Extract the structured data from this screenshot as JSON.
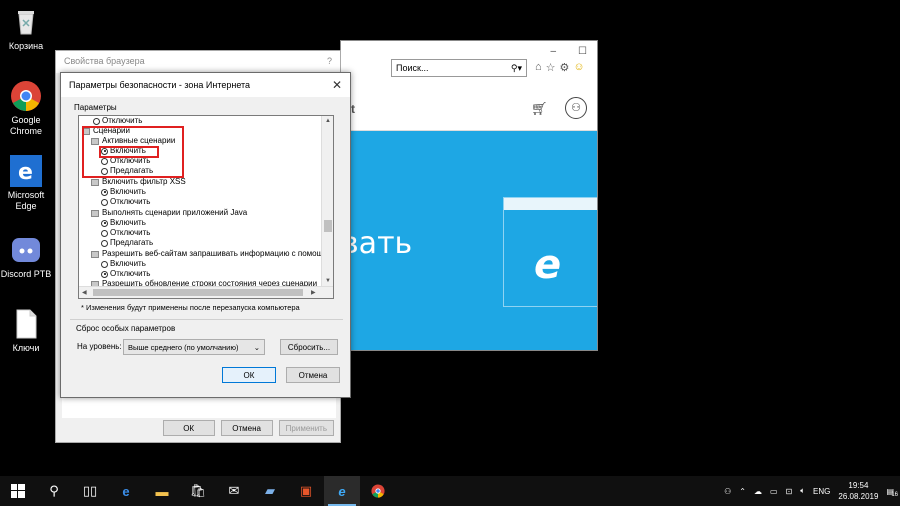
{
  "desktop": {
    "icons": [
      {
        "label": "Корзина",
        "icon": "recycle-bin-icon"
      },
      {
        "label": "Google Chrome",
        "icon": "chrome-icon"
      },
      {
        "label": "Microsoft Edge",
        "icon": "edge-icon"
      },
      {
        "label": "Discord PTB",
        "icon": "discord-icon"
      },
      {
        "label": "Ключи",
        "icon": "file-icon"
      }
    ]
  },
  "ie": {
    "search_placeholder": "Поиск...",
    "header_text": "ft",
    "hero_text": "вать",
    "title_min": "–",
    "title_max": "☐"
  },
  "props_dialog": {
    "title": "Свойства браузера",
    "help": "?",
    "ok": "ОК",
    "cancel": "Отмена",
    "apply": "Применить"
  },
  "security_dialog": {
    "title": "Параметры безопасности - зона Интернета",
    "params_label": "Параметры",
    "tree": [
      {
        "kind": "radio",
        "label": "Отключить",
        "checked": false
      },
      {
        "kind": "group",
        "label": "Сценарии"
      },
      {
        "kind": "subgroup",
        "label": "Активные сценарии"
      },
      {
        "kind": "radio",
        "label": "Включить",
        "checked": true
      },
      {
        "kind": "radio",
        "label": "Отключить",
        "checked": false
      },
      {
        "kind": "radio",
        "label": "Предлагать",
        "checked": false
      },
      {
        "kind": "subgroup",
        "label": "Включить фильтр XSS"
      },
      {
        "kind": "radio",
        "label": "Включить",
        "checked": true
      },
      {
        "kind": "radio",
        "label": "Отключить",
        "checked": false
      },
      {
        "kind": "subgroup",
        "label": "Выполнять сценарии приложений Java"
      },
      {
        "kind": "radio",
        "label": "Включить",
        "checked": true
      },
      {
        "kind": "radio",
        "label": "Отключить",
        "checked": false
      },
      {
        "kind": "radio",
        "label": "Предлагать",
        "checked": false
      },
      {
        "kind": "subgroup",
        "label": "Разрешить веб-сайтам запрашивать информацию с помощью о"
      },
      {
        "kind": "radio",
        "label": "Включить",
        "checked": false
      },
      {
        "kind": "radio",
        "label": "Отключить",
        "checked": true
      },
      {
        "kind": "subgroup",
        "label": "Разрешить обновление строки состояния через сценарии"
      }
    ],
    "note": "* Изменения будут применены после перезапуска компьютера",
    "reset_title": "Сброс особых параметров",
    "reset_level_label": "На уровень:",
    "reset_level_value": "Выше среднего (по умолчанию)",
    "reset_button": "Сбросить...",
    "ok": "ОК",
    "cancel": "Отмена"
  },
  "taskbar": {
    "lang": "ENG",
    "time": "19:54",
    "date": "26.08.2019",
    "notifications": "16"
  },
  "colors": {
    "accent_blue": "#1ea7e4",
    "highlight_red": "#e02020"
  }
}
